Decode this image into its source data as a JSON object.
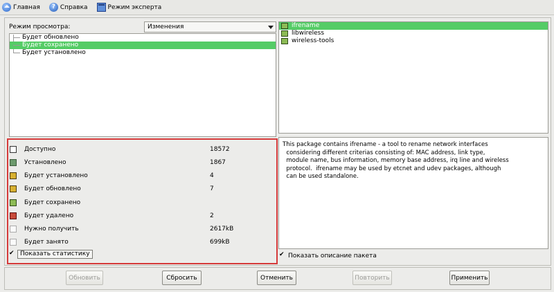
{
  "menubar": {
    "items": [
      {
        "label": "Главная",
        "icon": "home-icon"
      },
      {
        "label": "Справка",
        "icon": "help-icon"
      },
      {
        "label": "Режим эксперта",
        "icon": "expert-mode-icon"
      }
    ]
  },
  "view_mode": {
    "label": "Режим просмотра:",
    "selected": "Изменения"
  },
  "tree": {
    "items": [
      {
        "label": "Будет обновлено",
        "selected": false
      },
      {
        "label": "Будет сохранено",
        "selected": true
      },
      {
        "label": "Будет установлено",
        "selected": false
      }
    ]
  },
  "stats": {
    "rows": [
      {
        "label": "Доступно",
        "value": "18572",
        "icon": "available-icon"
      },
      {
        "label": "Установлено",
        "value": "1867",
        "icon": "installed-icon"
      },
      {
        "label": "Будет установлено",
        "value": "4",
        "icon": "to-install-icon"
      },
      {
        "label": "Будет обновлено",
        "value": "7",
        "icon": "to-update-icon"
      },
      {
        "label": "Будет сохранено",
        "value": "",
        "icon": "to-keep-icon"
      },
      {
        "label": "Будет удалено",
        "value": "2",
        "icon": "to-remove-icon"
      },
      {
        "label": "Нужно получить",
        "value": "2617kB",
        "icon": "download-size-icon"
      },
      {
        "label": "Будет занято",
        "value": "699kB",
        "icon": "disk-usage-icon"
      }
    ],
    "toggle_label": "Показать статистику",
    "toggle_checked": true
  },
  "packages": {
    "items": [
      {
        "name": "ifrename",
        "selected": true
      },
      {
        "name": "libwireless",
        "selected": false
      },
      {
        "name": "wireless-tools",
        "selected": false
      }
    ]
  },
  "description": {
    "text": "This package contains ifrename - a tool to rename network interfaces\n  considering different criterias consisting of: MAC address, link type,\n  module name, bus information, memory base address, irq line and wireless\n  protocol.  ifrename may be used by etcnet and udev packages, although\n  can be used standalone.",
    "toggle_label": "Показать описание пакета",
    "toggle_checked": true
  },
  "buttons": {
    "update": "Обновить",
    "reset": "Сбросить",
    "cancel": "Отменить",
    "repeat": "Повторить",
    "apply": "Применить"
  }
}
